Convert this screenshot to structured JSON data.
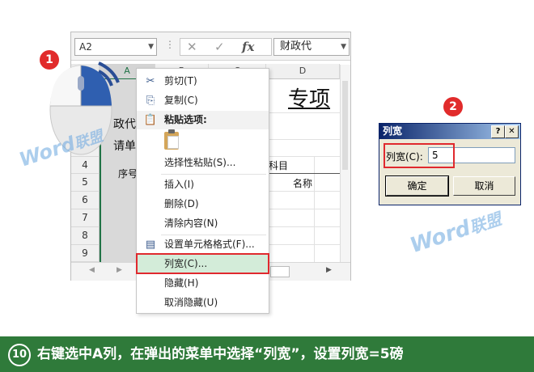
{
  "excel": {
    "name_box": "A2",
    "fx_symbol": "fx",
    "cancel_glyph": "✕",
    "enter_glyph": "✓",
    "formula_value": "财政代",
    "columns": [
      "A",
      "B",
      "C",
      "D"
    ],
    "rows": [
      "4",
      "5",
      "6",
      "7",
      "8",
      "9"
    ],
    "cells": {
      "title": "专项",
      "a2": "政代",
      "a3": "请单",
      "seq_header": "序号",
      "subject_header": "科目",
      "name_header": "名称"
    }
  },
  "context_menu": {
    "items": [
      {
        "label": "剪切(T)",
        "icon": "scissors-icon"
      },
      {
        "label": "复制(C)",
        "icon": "copy-icon"
      },
      {
        "label": "粘贴选项:",
        "icon": "clipboard-icon"
      },
      {
        "label": "选择性粘贴(S)...",
        "icon": ""
      },
      {
        "label": "插入(I)",
        "icon": ""
      },
      {
        "label": "删除(D)",
        "icon": ""
      },
      {
        "label": "清除内容(N)",
        "icon": ""
      },
      {
        "label": "设置单元格格式(F)...",
        "icon": "format-cells-icon"
      },
      {
        "label": "列宽(C)...",
        "icon": ""
      },
      {
        "label": "隐藏(H)",
        "icon": ""
      },
      {
        "label": "取消隐藏(U)",
        "icon": ""
      }
    ]
  },
  "dialog": {
    "title": "列宽",
    "help_glyph": "?",
    "close_glyph": "✕",
    "field_label": "列宽(C):",
    "field_value": "5",
    "ok_label": "确定",
    "cancel_label": "取消"
  },
  "badges": {
    "step1": "1",
    "step2": "2"
  },
  "watermark": {
    "prefix": "Word",
    "suffix": "联盟"
  },
  "banner": {
    "number": "10",
    "text": "右键选中A列，在弹出的菜单中选择“列宽”，设置列宽=5磅"
  },
  "colors": {
    "accent_green": "#217346",
    "banner_green": "#2f7a3a",
    "highlight_red": "#e0292e",
    "badge_red": "#e12b2b"
  }
}
